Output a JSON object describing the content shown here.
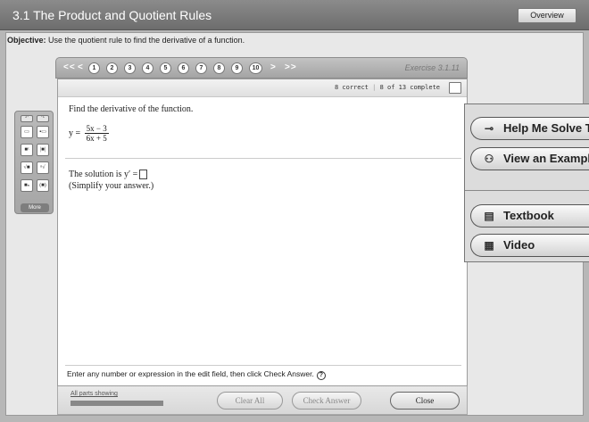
{
  "window": {
    "title": "3.1 The Product and Quotient Rules",
    "overview_label": "Overview"
  },
  "objective": {
    "label": "Objective:",
    "text": " Use the quotient rule to find the derivative of a function."
  },
  "nav": {
    "first": "<<",
    "prev": "<",
    "numbers": [
      "1",
      "2",
      "3",
      "4",
      "5",
      "6",
      "7",
      "8",
      "9",
      "10"
    ],
    "next": ">",
    "last": ">>",
    "exercise": "Exercise 3.1.11"
  },
  "status": {
    "correct": "8 correct",
    "sep": "|",
    "complete": "8 of 13 complete"
  },
  "question": {
    "prompt": "Find the derivative of the function.",
    "lhs": "y =",
    "numerator": "5x − 3",
    "denominator": "6x + 5",
    "solution_prefix": "The solution is y′ =",
    "simplify": "(Simplify your answer.)"
  },
  "hint": "Enter any number or expression in the edit field, then click Check Answer.",
  "footer": {
    "parts_label": "All parts showing",
    "parts_progress": 1.0,
    "clear_all": "Clear All",
    "check_answer": "Check Answer",
    "close": "Close"
  },
  "palette": {
    "more": "More"
  },
  "help": {
    "help_me_solve": "Help Me Solve This",
    "view_example": "View an Example",
    "textbook": "Textbook",
    "video": "Video"
  }
}
